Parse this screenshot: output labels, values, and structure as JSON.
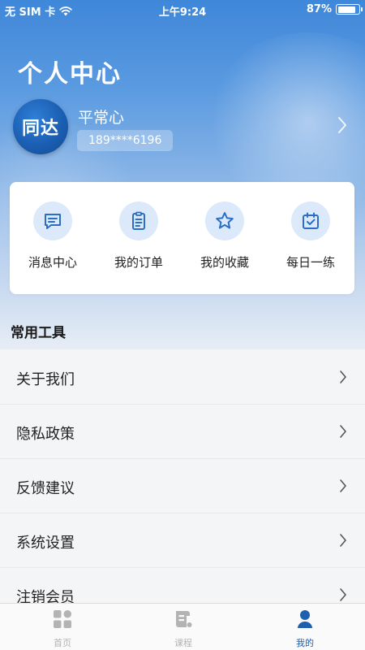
{
  "status_bar": {
    "carrier": "无 SIM 卡",
    "time": "上午9:24",
    "battery": "87%",
    "battery_level": 0.87
  },
  "header": {
    "title": "个人中心"
  },
  "profile": {
    "avatar_text": "同达",
    "name": "平常心",
    "phone": "189****6196"
  },
  "quick_actions": [
    {
      "label": "消息中心",
      "icon": "message-icon"
    },
    {
      "label": "我的订单",
      "icon": "order-icon"
    },
    {
      "label": "我的收藏",
      "icon": "star-icon"
    },
    {
      "label": "每日一练",
      "icon": "calendar-check-icon"
    }
  ],
  "tools": {
    "title": "常用工具",
    "items": [
      {
        "label": "关于我们"
      },
      {
        "label": "隐私政策"
      },
      {
        "label": "反馈建议"
      },
      {
        "label": "系统设置"
      },
      {
        "label": "注销会员"
      }
    ]
  },
  "tabbar": {
    "tabs": [
      {
        "label": "首页",
        "icon": "home-grid-icon",
        "active": false
      },
      {
        "label": "课程",
        "icon": "course-icon",
        "active": false
      },
      {
        "label": "我的",
        "icon": "person-icon",
        "active": true
      }
    ]
  },
  "colors": {
    "accent": "#1e5fae",
    "icon_blue": "#2a6fc4",
    "icon_bg": "#dbe9fb",
    "inactive": "#b3b3b3"
  }
}
